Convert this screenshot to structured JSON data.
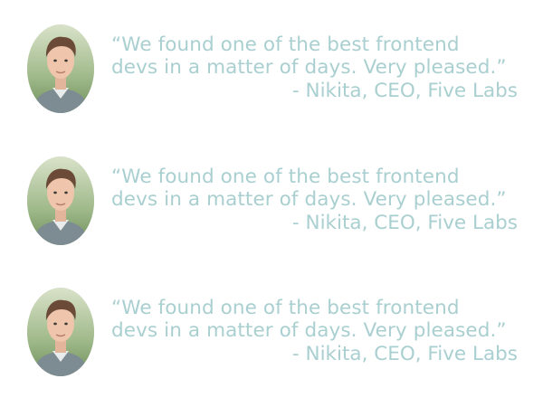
{
  "colors": {
    "text": "#aacfd0",
    "background": "#ffffff"
  },
  "testimonials": [
    {
      "avatar_icon": "person-photo-avatar",
      "quote_line1": "“We found one of the best frontend",
      "quote_line2": "devs in a matter of days. Very pleased.”",
      "attribution": "- Nikita, CEO, Five Labs"
    },
    {
      "avatar_icon": "person-photo-avatar",
      "quote_line1": "“We found one of the best frontend",
      "quote_line2": "devs in a matter of days. Very pleased.”",
      "attribution": "- Nikita, CEO, Five Labs"
    },
    {
      "avatar_icon": "person-photo-avatar",
      "quote_line1": "“We found one of the best frontend",
      "quote_line2": "devs in a matter of days. Very pleased.”",
      "attribution": "- Nikita, CEO, Five Labs"
    }
  ]
}
